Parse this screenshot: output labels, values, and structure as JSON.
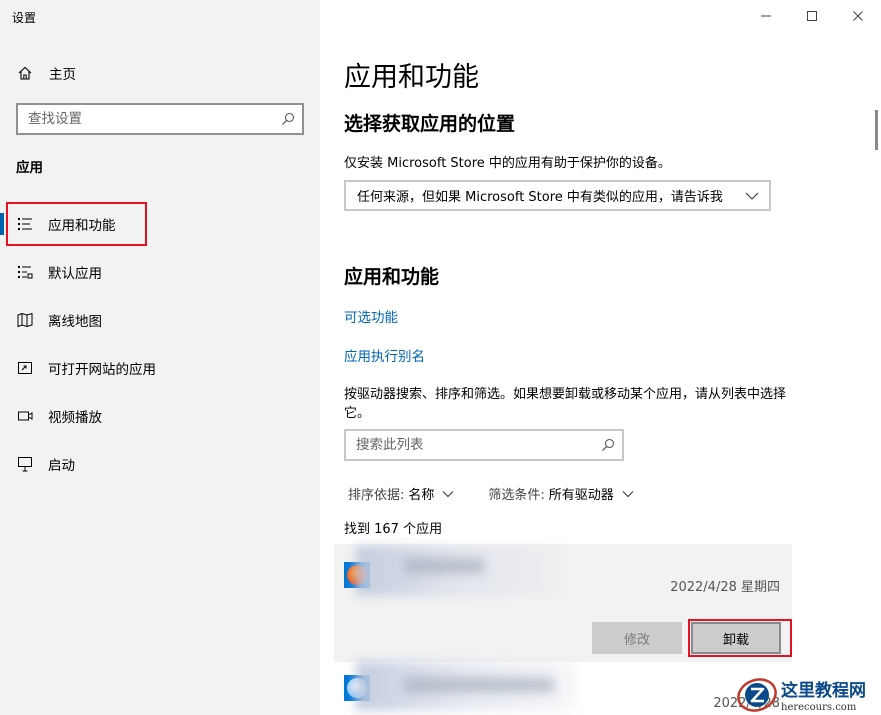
{
  "window": {
    "title": "设置",
    "controls": [
      "minimize-icon",
      "maximize-icon",
      "close-icon"
    ]
  },
  "sidebar": {
    "home_label": "主页",
    "search_placeholder": "查找设置",
    "section_heading": "应用",
    "items": [
      {
        "label": "应用和功能",
        "icon": "apps-list-icon",
        "active": true
      },
      {
        "label": "默认应用",
        "icon": "default-apps-icon",
        "active": false
      },
      {
        "label": "离线地图",
        "icon": "offline-maps-icon",
        "active": false
      },
      {
        "label": "可打开网站的应用",
        "icon": "apps-for-websites-icon",
        "active": false
      },
      {
        "label": "视频播放",
        "icon": "video-playback-icon",
        "active": false
      },
      {
        "label": "启动",
        "icon": "startup-icon",
        "active": false
      }
    ],
    "accent_color": "#0063b1"
  },
  "main": {
    "page_title": "应用和功能",
    "install_source": {
      "heading": "选择获取应用的位置",
      "description": "仅安装 Microsoft Store 中的应用有助于保护你的设备。",
      "selected_value": "任何来源，但如果 Microsoft Store 中有类似的应用，请告诉我"
    },
    "apps_section": {
      "heading": "应用和功能",
      "link_optional": "可选功能",
      "link_aliases": "应用执行别名",
      "description": "按驱动器搜索、排序和筛选。如果想要卸载或移动某个应用，请从列表中选择它。",
      "search_placeholder": "搜索此列表",
      "sort_label": "排序依据:",
      "sort_value": "名称",
      "filter_label": "筛选条件:",
      "filter_value": "所有驱动器",
      "count_text": "找到 167 个应用",
      "apps": [
        {
          "date": "2022/4/28 星期四",
          "expanded": true
        },
        {
          "date": "2022/4/28",
          "expanded": false
        }
      ],
      "modify_label": "修改",
      "uninstall_label": "卸载"
    },
    "link_color": "#0067b8"
  },
  "annotation_color": "#e81123",
  "watermark": {
    "main": "这里教程网",
    "sub": "herecours.com"
  }
}
